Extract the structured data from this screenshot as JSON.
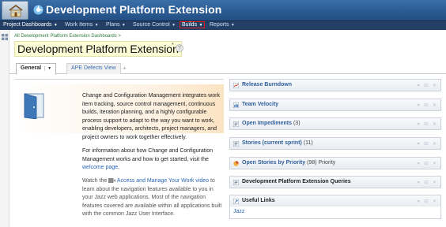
{
  "header": {
    "title": "Development Platform Extension",
    "home_icon": "home-icon",
    "logo_icon": "jazz-logo-icon"
  },
  "menu": {
    "items": [
      {
        "label": "Project Dashboards"
      },
      {
        "label": "Work Items"
      },
      {
        "label": "Plans"
      },
      {
        "label": "Source Control"
      },
      {
        "label": "Builds"
      },
      {
        "label": "Reports"
      }
    ],
    "selected": "Builds",
    "selected_color": "#e0201b"
  },
  "breadcrumb": "All Development Platform Extension Dashboards >",
  "page": {
    "title": "Development Platform Extension",
    "star": "*",
    "help": "?"
  },
  "tabs": {
    "items": [
      {
        "label": "General",
        "active": true
      },
      {
        "label": "APE Defects View",
        "active": false
      }
    ],
    "add": "+"
  },
  "welcome": {
    "p1": "Change and Configuration Management integrates work item tracking, source control management, continuous builds, iteration planning, and a highly configurable process support to adapt to the way you want to work, enabling developers, architects, project managers, and project owners to work together effectively.",
    "p2_before": "For information about how Change and Configuration Management works and how to get started, visit the",
    "p2_link": "welcome page",
    "p2_after": ".",
    "p3_before": "Watch the",
    "p3_link": "Access and Manage Your Work video",
    "p3_after": "to learn about the navigation features available to you in your Jazz web applications. Most of the navigation features covered are available within all applications built with the common Jazz User Interface."
  },
  "widgets": [
    {
      "title": "Release Burndown",
      "count": "",
      "extra": ""
    },
    {
      "title": "Team Velocity",
      "count": "",
      "extra": ""
    },
    {
      "title": "Open Impediments",
      "count": "(3)",
      "extra": ""
    },
    {
      "title": "Stories (current sprint)",
      "count": "(11)",
      "extra": ""
    },
    {
      "title": "Open Stories by Priority",
      "count": "(98)",
      "extra": "Priority"
    },
    {
      "title": "Development Platform Extension Queries",
      "count": "",
      "extra": ""
    },
    {
      "title": "Useful Links",
      "count": "",
      "extra": ""
    }
  ],
  "useful_links": [
    {
      "label": "Jazz"
    }
  ],
  "colors": {
    "title_bar": "#2a5a92",
    "menu_bar": "#243f66",
    "link": "#2a66b7",
    "breadcrumb": "#2c7a3d",
    "title_highlight": "#fbfbd6"
  }
}
